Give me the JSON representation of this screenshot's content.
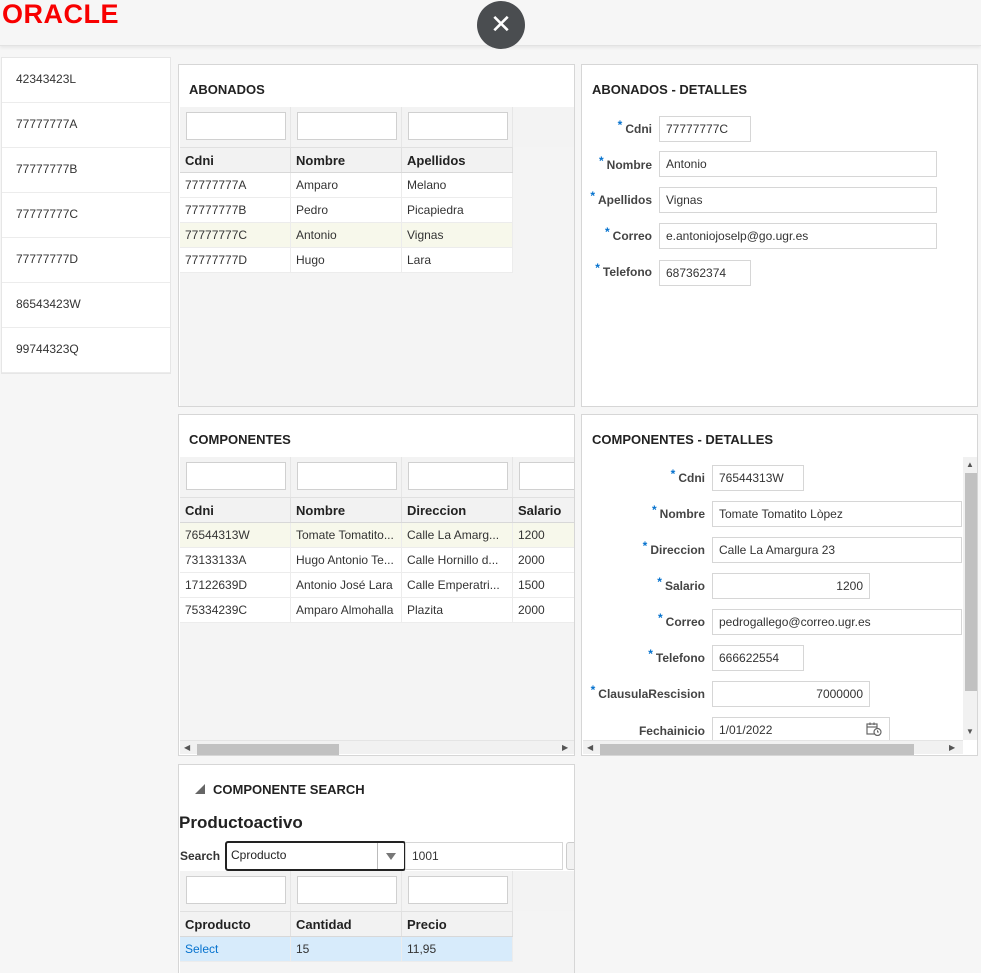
{
  "app": {
    "logo": "ORACLE",
    "close_glyph": "✕"
  },
  "sidebar": {
    "items": [
      "42343423L",
      "77777777A",
      "77777777B",
      "77777777C",
      "77777777D",
      "86543423W",
      "99744323Q"
    ]
  },
  "abonados": {
    "title": "ABONADOS",
    "columns": [
      "Cdni",
      "Nombre",
      "Apellidos"
    ],
    "rows": [
      [
        "77777777A",
        "Amparo",
        "Melano"
      ],
      [
        "77777777B",
        "Pedro",
        "Picapiedra"
      ],
      [
        "77777777C",
        "Antonio",
        "Vignas"
      ],
      [
        "77777777D",
        "Hugo",
        "Lara"
      ]
    ],
    "selected_row": 2
  },
  "abonados_detalles": {
    "title": "ABONADOS - DETALLES",
    "fields": [
      {
        "label": "Cdni",
        "value": "77777777C"
      },
      {
        "label": "Nombre",
        "value": "Antonio"
      },
      {
        "label": "Apellidos",
        "value": "Vignas"
      },
      {
        "label": "Correo",
        "value": "e.antoniojoselp@go.ugr.es"
      },
      {
        "label": "Telefono",
        "value": "687362374"
      }
    ]
  },
  "componentes": {
    "title": "COMPONENTES",
    "columns": [
      "Cdni",
      "Nombre",
      "Direccion",
      "Salario"
    ],
    "rows": [
      [
        "76544313W",
        "Tomate Tomatito...",
        "Calle La Amarg...",
        "1200"
      ],
      [
        "73133133A",
        "Hugo Antonio Te...",
        "Calle Hornillo d...",
        "2000"
      ],
      [
        "17122639D",
        "Antonio José Lara",
        "Calle Emperatri...",
        "1500"
      ],
      [
        "75334239C",
        "Amparo Almohalla",
        "Plazita",
        "2000"
      ]
    ],
    "selected_row": 0
  },
  "componentes_detalles": {
    "title": "COMPONENTES - DETALLES",
    "fields": [
      {
        "label": "Cdni",
        "value": "76544313W"
      },
      {
        "label": "Nombre",
        "value": "Tomate Tomatito Lòpez"
      },
      {
        "label": "Direccion",
        "value": "Calle La Amargura 23"
      },
      {
        "label": "Salario",
        "value": "1200"
      },
      {
        "label": "Correo",
        "value": "pedrogallego@correo.ugr.es"
      },
      {
        "label": "Telefono",
        "value": "666622554"
      },
      {
        "label": "ClausulaRescision",
        "value": "7000000"
      },
      {
        "label": "Fechainicio",
        "value": "1/01/2022"
      }
    ]
  },
  "search": {
    "title": "COMPONENTE SEARCH",
    "heading": "Productoactivo",
    "search_label": "Search",
    "select_value": "Cproducto",
    "input_value": "1001",
    "columns": [
      "Cproducto",
      "Cantidad",
      "Precio"
    ],
    "rows": [
      [
        "Select",
        "15",
        "11,95"
      ]
    ]
  }
}
